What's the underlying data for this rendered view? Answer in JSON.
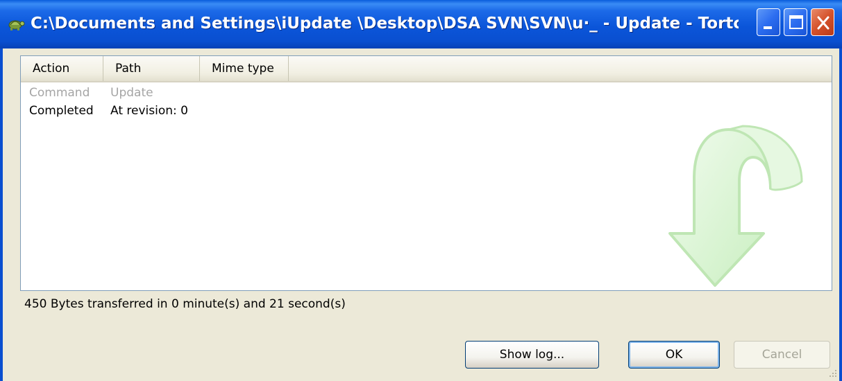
{
  "window": {
    "title": "C:\\Documents and Settings\\iUpdate \\Desktop\\DSA SVN\\SVN\\u·_ - Update - TortoiseSV…"
  },
  "listview": {
    "columns": [
      "Action",
      "Path",
      "Mime type"
    ],
    "rows": [
      {
        "action": "Command",
        "path": "Update",
        "style": "gray"
      },
      {
        "action": "Completed",
        "path": "At revision: 0",
        "style": "black"
      }
    ]
  },
  "status": {
    "text": "450 Bytes transferred in 0 minute(s) and 21 second(s)"
  },
  "buttons": {
    "show_log": "Show log...",
    "ok": "OK",
    "cancel": "Cancel"
  },
  "colors": {
    "titlebar": "#0a4fd0",
    "window_bg": "#ece9d8",
    "watermark_arrow": "#d9f5d3"
  },
  "icons": {
    "app": "tortoise-icon",
    "watermark": "update-arrow-icon"
  }
}
